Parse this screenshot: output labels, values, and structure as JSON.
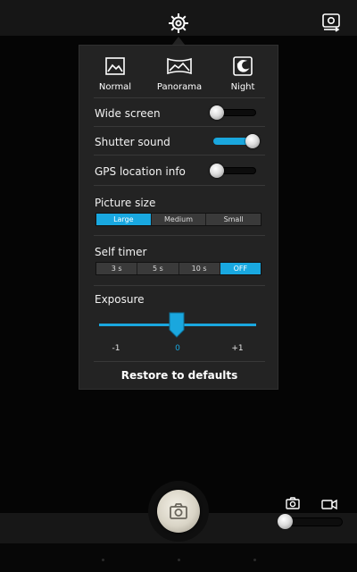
{
  "top_bar": {
    "settings_icon": "gear-icon",
    "switch_camera_icon": "switch-camera-icon"
  },
  "modes": [
    {
      "label": "Normal",
      "icon": "image-icon"
    },
    {
      "label": "Panorama",
      "icon": "panorama-icon"
    },
    {
      "label": "Night",
      "icon": "night-mode-icon"
    }
  ],
  "settings": {
    "wide_screen": {
      "label": "Wide screen",
      "on": false
    },
    "shutter_sound": {
      "label": "Shutter sound",
      "on": true
    },
    "gps": {
      "label": "GPS location info",
      "on": false
    }
  },
  "picture_size": {
    "label": "Picture size",
    "options": [
      "Large",
      "Medium",
      "Small"
    ],
    "selected": "Large"
  },
  "self_timer": {
    "label": "Self timer",
    "options": [
      "3 s",
      "5 s",
      "10 s",
      "OFF"
    ],
    "selected": "OFF"
  },
  "exposure": {
    "label": "Exposure",
    "ticks": [
      "-1",
      "0",
      "+1"
    ],
    "value": 0,
    "min": -1,
    "max": 1
  },
  "restore_label": "Restore to defaults",
  "bottom": {
    "shutter_icon": "camera-icon",
    "photo_mode_icon": "camera-icon",
    "video_mode_icon": "video-camera-icon",
    "mode_selected": "photo"
  },
  "colors": {
    "accent": "#1aa7de",
    "panel": "#232323",
    "background": "#050505"
  }
}
